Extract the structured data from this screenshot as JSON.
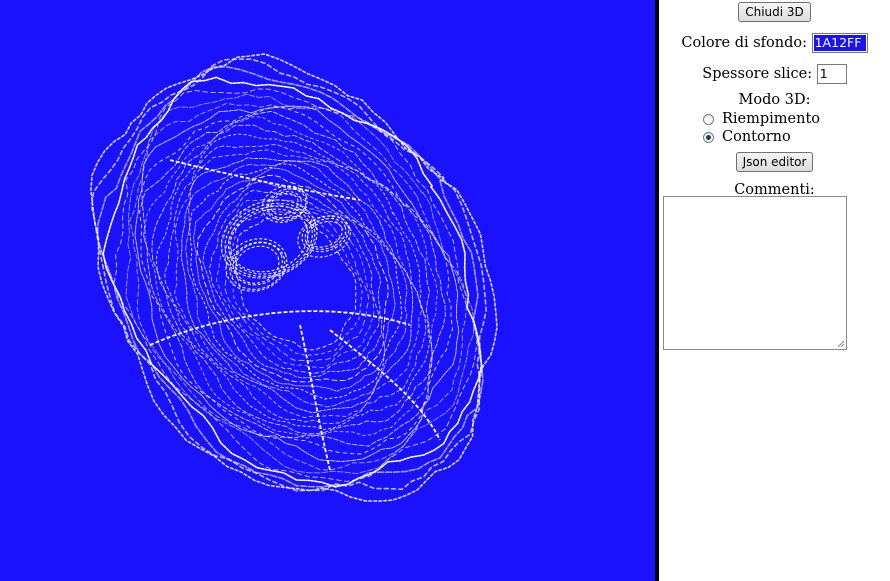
{
  "viewport": {
    "background_color": "#1A12FF",
    "render_color": "#ffffff",
    "mode": "outline"
  },
  "panel": {
    "close_button": "Chiudi 3D",
    "background_label": "Colore di sfondo:",
    "background_value": "1A12FF",
    "thickness_label": "Spessore slice:",
    "thickness_value": "1",
    "mode_label": "Modo 3D:",
    "mode_options": [
      {
        "label": "Riempimento",
        "checked": false
      },
      {
        "label": "Contorno",
        "checked": true
      }
    ],
    "json_button": "Json editor",
    "comments_label": "Commenti:",
    "comments_value": ""
  }
}
